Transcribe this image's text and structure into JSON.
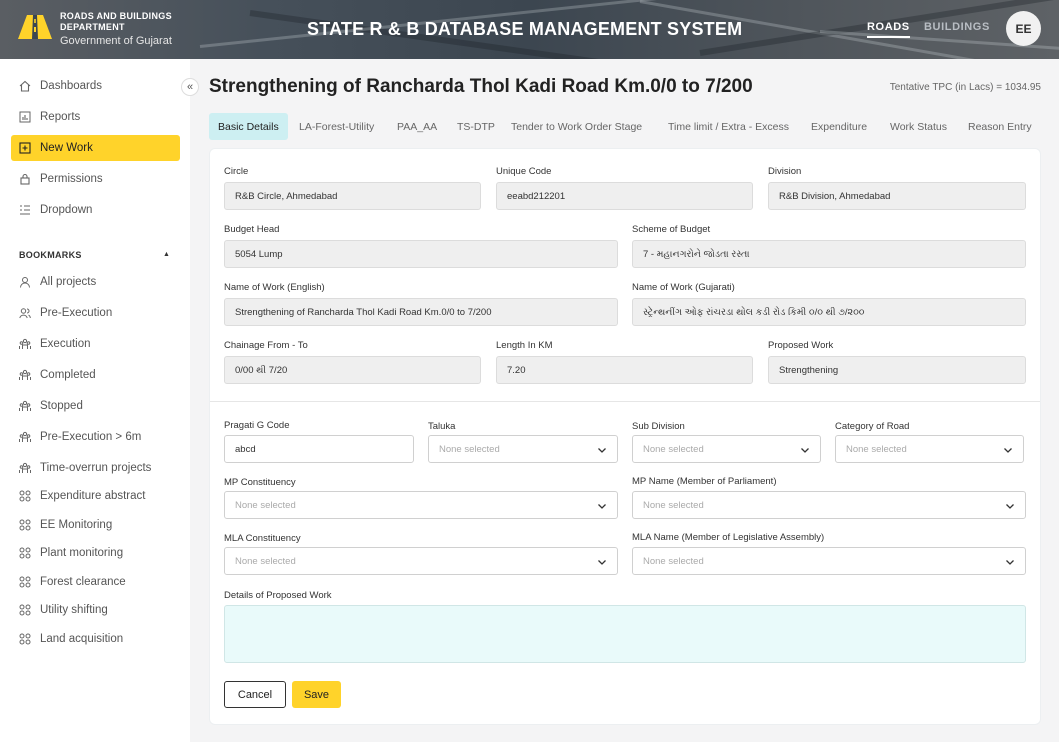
{
  "header": {
    "dept_line1": "ROADS AND BUILDINGS",
    "dept_line2": "DEPARTMENT",
    "dept_line3": "Government of Gujarat",
    "app_title": "STATE R & B DATABASE MANAGEMENT SYSTEM",
    "nav_roads": "ROADS",
    "nav_buildings": "BUILDINGS",
    "avatar": "EE"
  },
  "sidebar": {
    "collapse_icon": "«",
    "menu": [
      {
        "label": "Dashboards",
        "icon": "home-icon"
      },
      {
        "label": "Reports",
        "icon": "chart-icon"
      },
      {
        "label": "New Work",
        "icon": "plus-square-icon",
        "active": true
      },
      {
        "label": "Permissions",
        "icon": "lock-icon"
      },
      {
        "label": "Dropdown",
        "icon": "list-icon"
      }
    ],
    "bookmarks_heading": "BOOKMARKS",
    "bookmarks_caret": "▲",
    "bookmarks": [
      {
        "label": "All projects",
        "icon": "user-icon"
      },
      {
        "label": "Pre-Execution",
        "icon": "users-icon"
      },
      {
        "label": "Execution",
        "icon": "group-icon"
      },
      {
        "label": "Completed",
        "icon": "group-icon"
      },
      {
        "label": "Stopped",
        "icon": "group-icon"
      },
      {
        "label": "Pre-Execution > 6m",
        "icon": "group-icon"
      },
      {
        "label": "Time-overrun projects",
        "icon": "group-icon"
      },
      {
        "label": "Expenditure abstract",
        "icon": "grid-icon"
      },
      {
        "label": "EE Monitoring",
        "icon": "grid-icon"
      },
      {
        "label": "Plant monitoring",
        "icon": "grid-icon"
      },
      {
        "label": "Forest clearance",
        "icon": "grid-icon"
      },
      {
        "label": "Utility shifting",
        "icon": "grid-icon"
      },
      {
        "label": "Land acquisition",
        "icon": "grid-icon"
      }
    ]
  },
  "page": {
    "title": "Strengthening of Rancharda Thol Kadi Road Km.0/0 to 7/200",
    "tpc": "Tentative TPC (in Lacs) = 1034.95"
  },
  "tabs": [
    {
      "label": "Basic Details",
      "active": true
    },
    {
      "label": "LA-Forest-Utility"
    },
    {
      "label": "PAA_AA"
    },
    {
      "label": "TS-DTP"
    },
    {
      "label": "Tender to Work Order Stage"
    },
    {
      "label": "Time limit / Extra - Excess"
    },
    {
      "label": "Expenditure"
    },
    {
      "label": "Work Status"
    },
    {
      "label": "Reason Entry"
    }
  ],
  "form": {
    "circle": {
      "label": "Circle",
      "value": "R&B Circle, Ahmedabad"
    },
    "unique_code": {
      "label": "Unique Code",
      "value": "eeabd212201"
    },
    "division": {
      "label": "Division",
      "value": "R&B Division, Ahmedabad"
    },
    "budget_head": {
      "label": "Budget Head",
      "value": "5054 Lump"
    },
    "scheme": {
      "label": "Scheme of Budget",
      "value": "7 - મહાનગરોને જોડતા રસ્તા"
    },
    "name_en": {
      "label": "Name of Work (English)",
      "value": "Strengthening of Rancharda Thol Kadi Road Km.0/0 to 7/200"
    },
    "name_gu": {
      "label": "Name of Work (Gujarati)",
      "value": "સ્ટ્રેન્થનીંગ ઓફ રાંચરડા થોલ કડી રોડ કિમી ૦/૦ થી ૭/૨૦૦"
    },
    "chainage": {
      "label": "Chainage From - To",
      "value": "0/00 થી 7/20"
    },
    "length": {
      "label": "Length In KM",
      "value": "7.20"
    },
    "proposed": {
      "label": "Proposed Work",
      "value": "Strengthening"
    },
    "pragati": {
      "label": "Pragati G Code",
      "value": "abcd"
    },
    "taluka": {
      "label": "Taluka",
      "placeholder": "None selected"
    },
    "subdivision": {
      "label": "Sub Division",
      "placeholder": "None selected"
    },
    "category": {
      "label": "Category of Road",
      "placeholder": "None selected"
    },
    "mp_const": {
      "label": "MP Constituency",
      "placeholder": "None selected"
    },
    "mp_name": {
      "label": "MP Name (Member of Parliament)",
      "placeholder": "None selected"
    },
    "mla_const": {
      "label": "MLA Constituency",
      "placeholder": "None selected"
    },
    "mla_name": {
      "label": "MLA Name (Member of Legislative Assembly)",
      "placeholder": "None selected"
    },
    "details": {
      "label": "Details of Proposed Work",
      "value": ""
    },
    "cancel": "Cancel",
    "save": "Save"
  },
  "colors": {
    "accent": "#ffd32a",
    "active_tab": "#cdeff2",
    "textarea": "#e9fafa"
  }
}
